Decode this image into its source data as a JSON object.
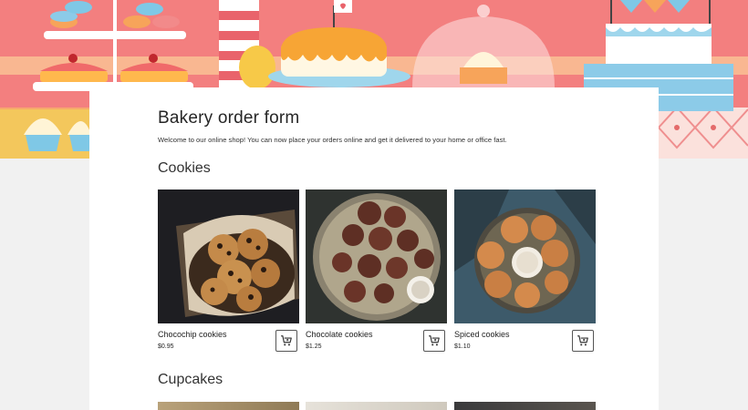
{
  "form": {
    "title": "Bakery order form",
    "description": "Welcome to our online shop! You can now place your orders online and get it delivered to your home or office fast."
  },
  "sections": [
    {
      "title": "Cookies",
      "products": [
        {
          "name": "Chocochip cookies",
          "price": "$0.95",
          "image_icon": "chocochip-cookies-photo",
          "cart_icon": "add-to-cart-icon"
        },
        {
          "name": "Chocolate cookies",
          "price": "$1.25",
          "image_icon": "chocolate-cookies-photo",
          "cart_icon": "add-to-cart-icon"
        },
        {
          "name": "Spiced cookies",
          "price": "$1.10",
          "image_icon": "spiced-cookies-photo",
          "cart_icon": "add-to-cart-icon"
        }
      ]
    },
    {
      "title": "Cupcakes"
    }
  ],
  "colors": {
    "banner": "#f37f7f",
    "page_background": "#f1f1f1",
    "card_background": "#ffffff",
    "text": "#262626"
  }
}
